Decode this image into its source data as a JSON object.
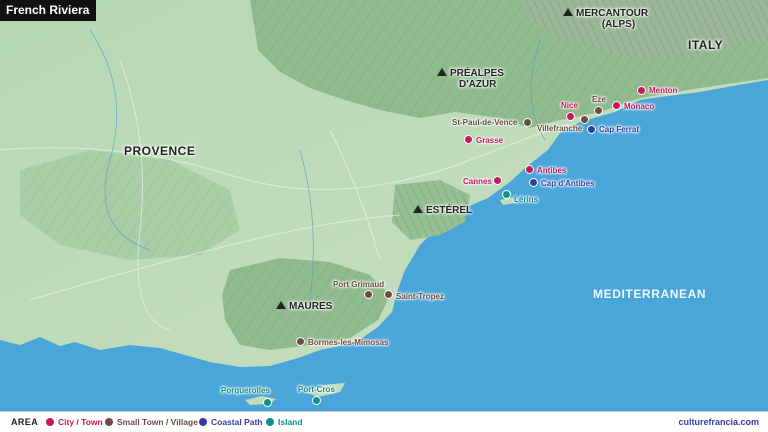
{
  "title": "French Riviera",
  "regions": {
    "provence": "PROVENCE",
    "italy": "ITALY",
    "sea": "MEDITERRANEAN"
  },
  "mountains": {
    "mercantour_1": "MERCANTOUR",
    "mercantour_2": "(ALPS)",
    "prealpes_1": "PRÉALPES",
    "prealpes_2": "D'AZUR",
    "esterel": "ESTÉREL",
    "maures": "MAURES"
  },
  "places": [
    {
      "name": "Menton",
      "category": "city"
    },
    {
      "name": "Monaco",
      "category": "city"
    },
    {
      "name": "Eze",
      "category": "village"
    },
    {
      "name": "Nice",
      "category": "city"
    },
    {
      "name": "Villefranche",
      "category": "village"
    },
    {
      "name": "Cap Ferrat",
      "category": "path"
    },
    {
      "name": "St-Paul-de-Vence",
      "category": "village"
    },
    {
      "name": "Grasse",
      "category": "city"
    },
    {
      "name": "Antibes",
      "category": "city"
    },
    {
      "name": "Cannes",
      "category": "city"
    },
    {
      "name": "Cap d'Antibes",
      "category": "path"
    },
    {
      "name": "Lérins",
      "category": "island"
    },
    {
      "name": "Port Grimaud",
      "category": "village"
    },
    {
      "name": "Saint-Tropez",
      "category": "village"
    },
    {
      "name": "Bormes-les-Mimosas",
      "category": "village"
    },
    {
      "name": "Porquerolles",
      "category": "island"
    },
    {
      "name": "Port-Cros",
      "category": "island"
    }
  ],
  "legend": {
    "title": "AREA",
    "items": [
      {
        "label": "City / Town",
        "color": "#c8175d"
      },
      {
        "label": "Small Town / Village",
        "color": "#6d4c41"
      },
      {
        "label": "Coastal Path",
        "color": "#303f9f"
      },
      {
        "label": "Island",
        "color": "#0f8f8a"
      }
    ]
  },
  "credit": "culturefrancia.com",
  "colors": {
    "sea": "#4aa6d8",
    "land": "#b9d8b8",
    "hills": "#87b58b",
    "city": "#c8175d",
    "village": "#6d4c41",
    "path": "#303f9f",
    "island": "#0f8f8a"
  }
}
